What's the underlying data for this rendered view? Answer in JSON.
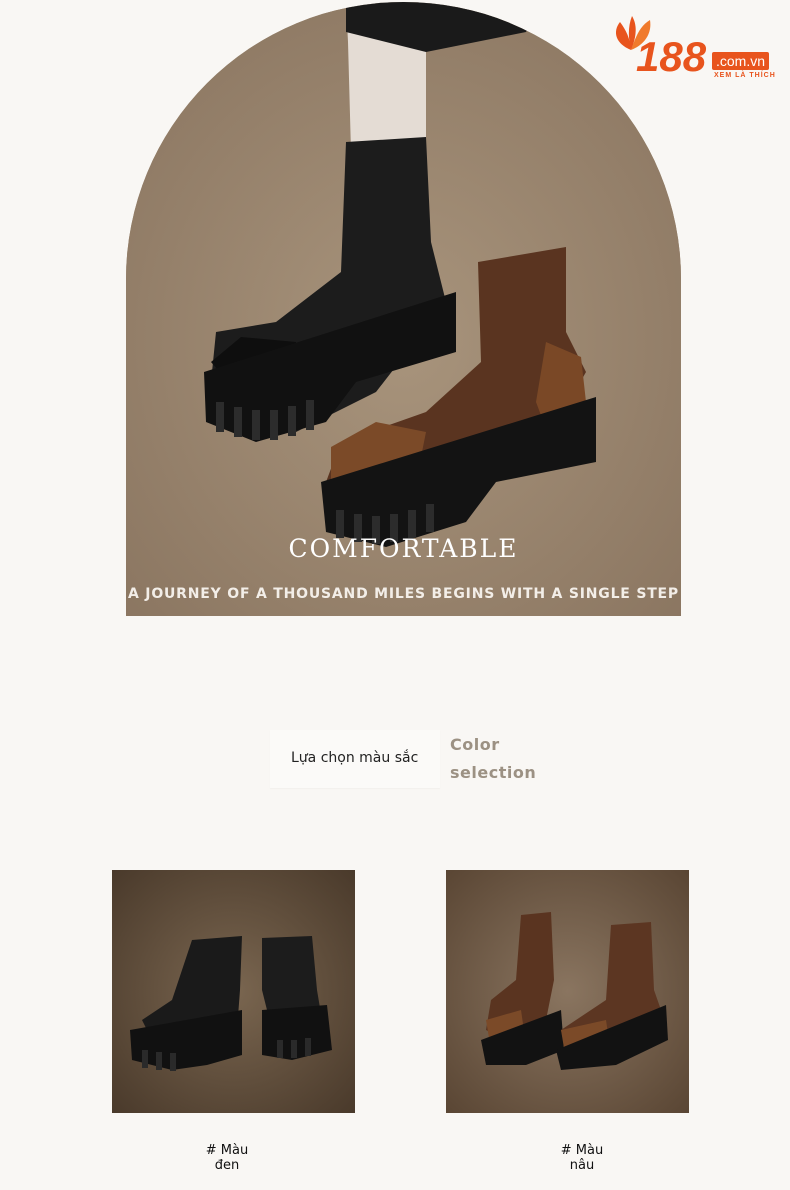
{
  "brand": {
    "number": "188",
    "domain": ".com.vn",
    "tagline": "XEM LÀ THÍCH",
    "color": "#e8541d"
  },
  "hero": {
    "headline": "COMFORTABLE",
    "subline": "A JOURNEY OF A THOUSAND MILES BEGINS WITH A SINGLE STEP"
  },
  "color_selection": {
    "label_vi": "Lựa chọn màu sắc",
    "label_en_line1": "Color",
    "label_en_line2": "selection"
  },
  "products": [
    {
      "caption_line1": "# Màu",
      "caption_line2": "đen"
    },
    {
      "caption_line1": "# Màu",
      "caption_line2": "nâu"
    }
  ]
}
